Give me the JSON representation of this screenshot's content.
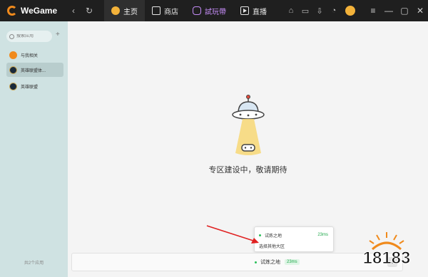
{
  "app": {
    "title": "WeGame"
  },
  "nav": {
    "back": "‹",
    "refresh": "↻"
  },
  "tabs": [
    {
      "label": "主页"
    },
    {
      "label": "商店"
    },
    {
      "label": "試玩帶"
    },
    {
      "label": "直播"
    }
  ],
  "window": {
    "menu": "≡",
    "minimize": "—",
    "maximize": "▢",
    "close": "✕"
  },
  "sidebar": {
    "search_placeholder": "搜索应用",
    "add": "+",
    "items": [
      {
        "label": "与我相关"
      },
      {
        "label": "英雄联盟体..."
      },
      {
        "label": "英雄联盟"
      }
    ],
    "footer": "共2个应用"
  },
  "main": {
    "empty_message": "专区建设中，敬请期待"
  },
  "server": {
    "current_name": "试炼之地",
    "current_ping": "23ms",
    "dropdown": "⌄",
    "options": [
      {
        "name": "试炼之地",
        "ping": "23ms"
      },
      {
        "name": "选择其他大区"
      }
    ]
  },
  "watermark": {
    "text": "18183"
  },
  "colors": {
    "accent": "#f08a1c",
    "ping_green": "#1fa84a",
    "sidebar_bg": "#cfe2e2",
    "titlebar_bg": "#1f1f1f",
    "arrow_red": "#e02020"
  }
}
